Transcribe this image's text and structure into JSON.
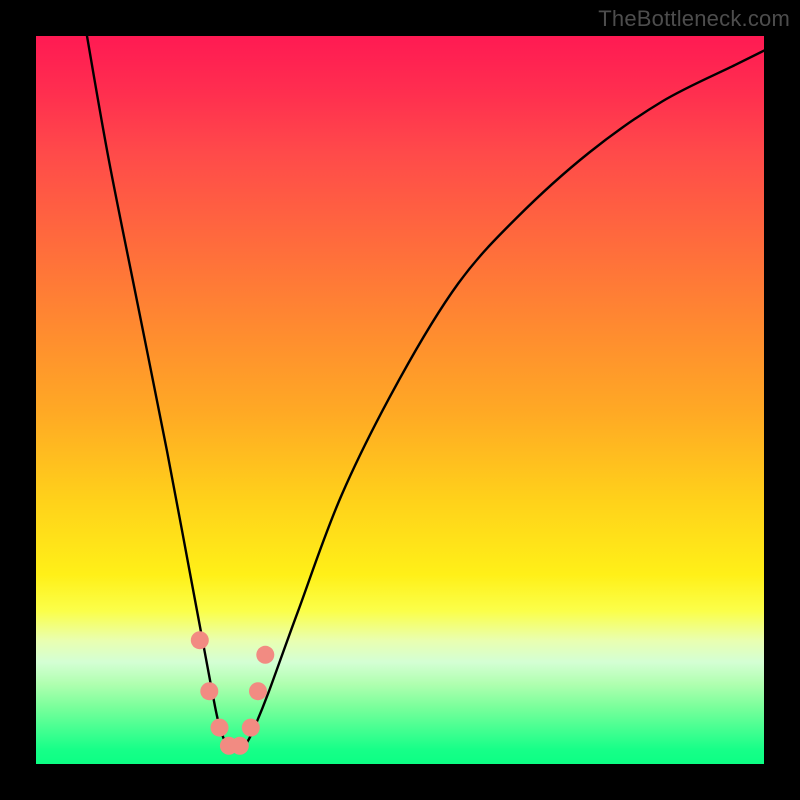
{
  "watermark": "TheBottleneck.com",
  "colors": {
    "frame": "#000000",
    "gradient_top": "#ff1a53",
    "gradient_bottom": "#0cff84",
    "curve": "#000000",
    "marker": "#f28b82"
  },
  "chart_data": {
    "type": "line",
    "title": "",
    "xlabel": "",
    "ylabel": "",
    "xlim": [
      0,
      100
    ],
    "ylim": [
      0,
      100
    ],
    "grid": false,
    "legend": false,
    "note": "Axes are unlabeled in the source image; x and y are normalized 0–100 read off pixel positions. The single black curve forms an asymmetric V with its minimum near x≈27. Marker points highlight the floor of the V.",
    "series": [
      {
        "name": "curve",
        "x": [
          7,
          10,
          14,
          18,
          21,
          24,
          25,
          26,
          27,
          28,
          29,
          30,
          32,
          36,
          42,
          50,
          58,
          66,
          76,
          86,
          96,
          100
        ],
        "values": [
          100,
          83,
          63,
          43,
          27,
          11,
          6,
          3,
          2,
          2,
          3,
          5,
          10,
          21,
          37,
          53,
          66,
          75,
          84,
          91,
          96,
          98
        ]
      }
    ],
    "markers": [
      {
        "x": 22.5,
        "y": 17
      },
      {
        "x": 23.8,
        "y": 10
      },
      {
        "x": 25.2,
        "y": 5
      },
      {
        "x": 26.5,
        "y": 2.5
      },
      {
        "x": 28.0,
        "y": 2.5
      },
      {
        "x": 29.5,
        "y": 5
      },
      {
        "x": 30.5,
        "y": 10
      },
      {
        "x": 31.5,
        "y": 15
      }
    ]
  }
}
